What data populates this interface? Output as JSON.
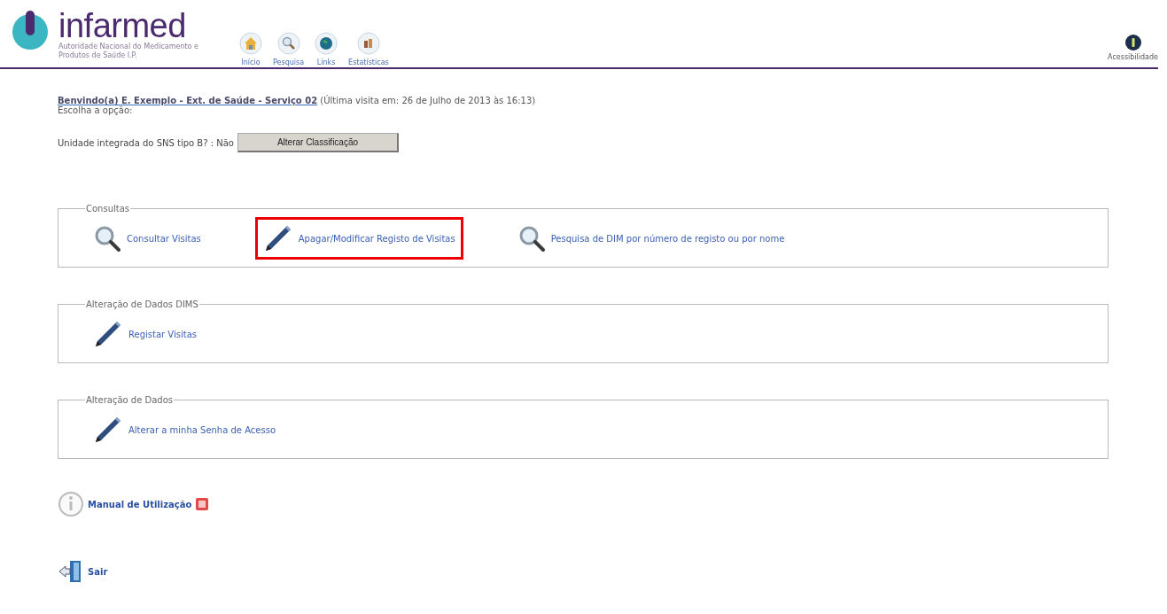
{
  "header": {
    "logo_name": "infarmed",
    "logo_tagline": "Autoridade Nacional do Medicamento e Produtos de Saúde I.P.",
    "nav": [
      {
        "kind": "home",
        "label": "Início"
      },
      {
        "kind": "search",
        "label": "Pesquisa"
      },
      {
        "kind": "globe",
        "label": "Links"
      },
      {
        "kind": "stats",
        "label": "Estatísticas"
      }
    ],
    "accessibility": {
      "label": "Acessibilidade"
    }
  },
  "welcome": "**Benvindo(a) E. Exemplo - Ext. de Saúde - Serviço 02** (Última visita em: 26 de Julho de 2013 às 16:13)",
  "prompt": "Escolha a opção:",
  "classification": {
    "label": "Unidade integrada do SNS tipo B? : Não",
    "button": "Alterar Classificação"
  },
  "sections": [
    {
      "legend": "Consultas",
      "items": [
        {
          "kind": "magnifier",
          "label": "Consultar Visitas",
          "highlighted": false
        },
        {
          "kind": "pencil",
          "label": "Apagar/Modificar Registo de Visitas",
          "highlighted": true
        },
        {
          "kind": "magnifier",
          "label": "Pesquisa de DIM por número de registo ou por nome",
          "highlighted": false
        }
      ]
    },
    {
      "legend": "Alteração de Dados DIMS",
      "items": [
        {
          "kind": "pencil",
          "label": "Registar Visitas",
          "highlighted": false
        }
      ]
    },
    {
      "legend": "Alteração de Dados",
      "items": [
        {
          "kind": "pencil",
          "label": "Alterar a minha Senha de Acesso",
          "highlighted": false
        }
      ]
    }
  ],
  "manual": {
    "label": "Manual de Utilização"
  },
  "logout": {
    "label": "Sair"
  }
}
